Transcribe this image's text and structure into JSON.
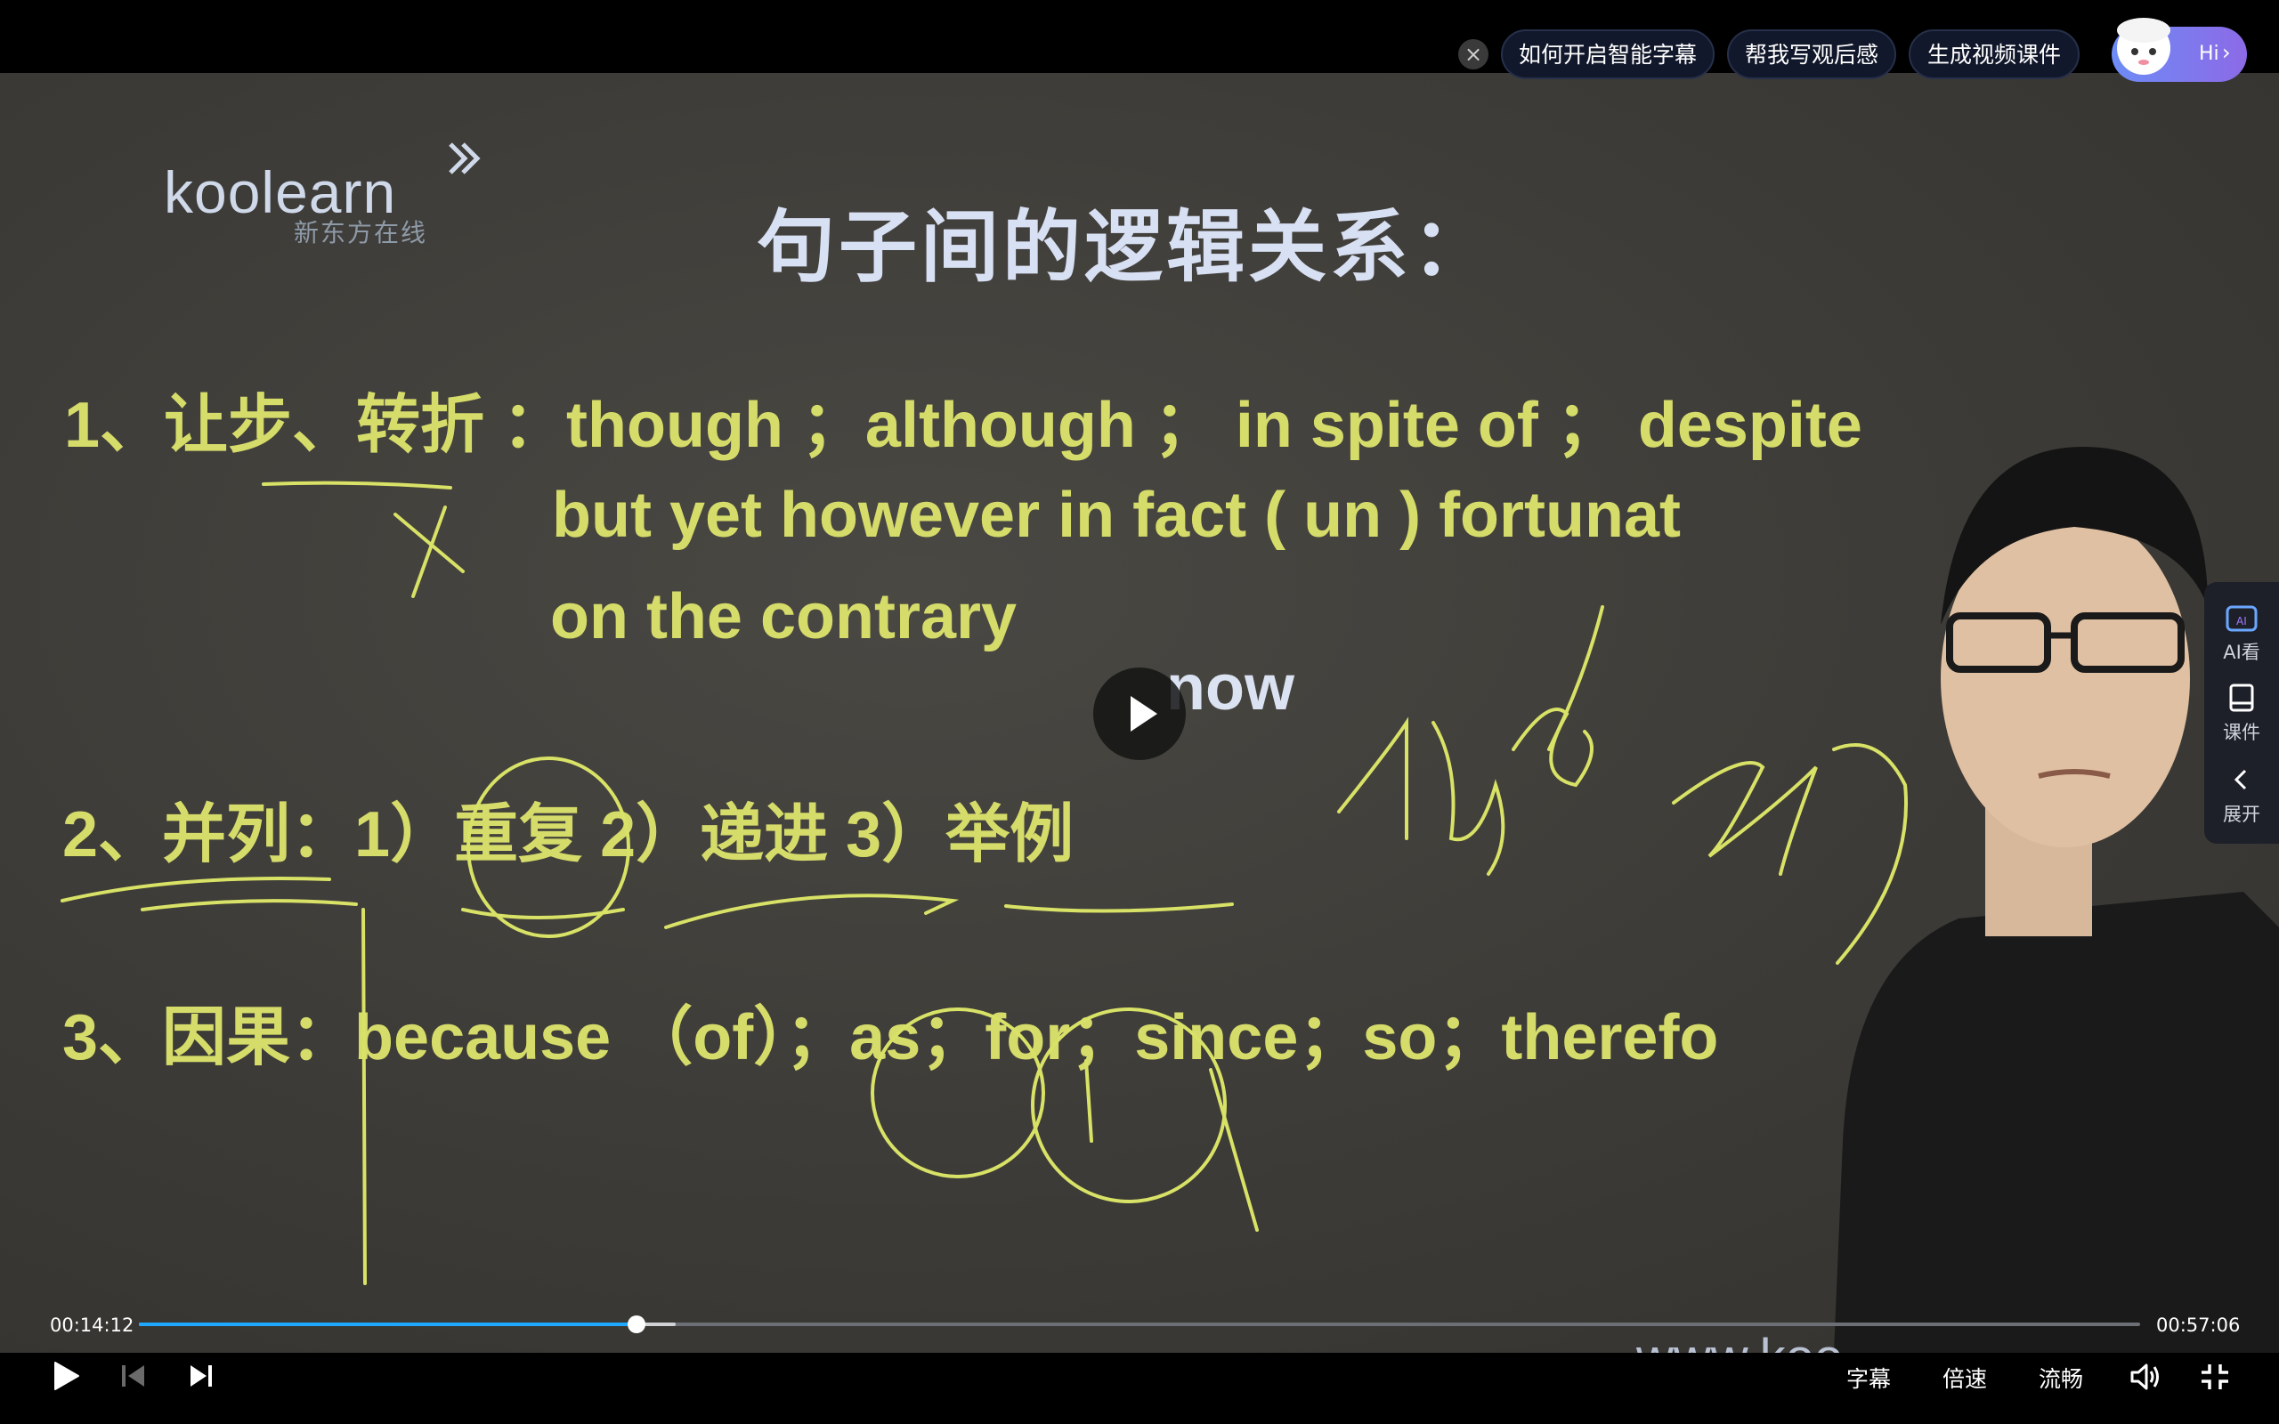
{
  "suggestions": {
    "items": [
      "如何开启智能字幕",
      "帮我写观后感",
      "生成视频课件"
    ],
    "hi_label": "Hi"
  },
  "slide": {
    "logo": "koolearn",
    "logo_sub": "新东方在线",
    "title": "句子间的逻辑关系：",
    "line1": "1、让步、转折 ：though ；although ； in spite of ； despite",
    "line2": "but  yet   however  in fact    ( un ) fortunat",
    "line3": "on the  contrary",
    "line3_now": "now",
    "line4": "2、并列：1）重复  2）递进  3）举例",
    "line5": "3、因果：because （of）；as；for；since；so；therefo",
    "url": "www.koo"
  },
  "side_panel": {
    "items": [
      "AI看",
      "课件",
      "展开"
    ]
  },
  "player": {
    "current_time": "00:14:12",
    "total_time": "00:57:06",
    "progress_fraction": 0.2487,
    "subtitle_label": "字幕",
    "speed_label": "倍速",
    "quality_label": "流畅"
  },
  "colors": {
    "progress": "#1fa8ff",
    "board_text": "#d5dc6a",
    "hi_gradient": "#6d8cf6"
  }
}
